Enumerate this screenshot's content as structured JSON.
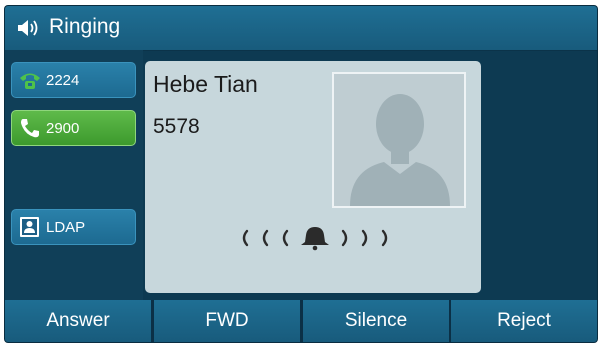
{
  "status": {
    "title": "Ringing",
    "icon": "speaker-icon"
  },
  "lines": [
    {
      "label": "2224",
      "icon": "phone-handset-icon",
      "state": "idle"
    },
    {
      "label": "2900",
      "icon": "phone-ringing-icon",
      "state": "active"
    },
    {
      "label": "LDAP",
      "icon": "directory-contact-icon",
      "state": "idle"
    }
  ],
  "caller": {
    "name": "Hebe Tian",
    "number": "5578",
    "avatar_icon": "default-avatar-icon",
    "ring_icon": "bell-ringing-icon"
  },
  "softkeys": [
    "Answer",
    "FWD",
    "Silence",
    "Reject"
  ],
  "colors": {
    "active_line": "#4caf3a",
    "bar": "#1d6a8f",
    "card": "#c7d7dc"
  }
}
